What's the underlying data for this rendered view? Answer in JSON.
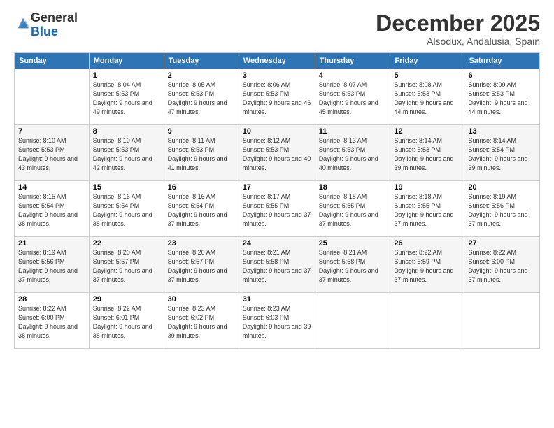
{
  "logo": {
    "general": "General",
    "blue": "Blue"
  },
  "header": {
    "month": "December 2025",
    "location": "Alsodux, Andalusia, Spain"
  },
  "weekdays": [
    "Sunday",
    "Monday",
    "Tuesday",
    "Wednesday",
    "Thursday",
    "Friday",
    "Saturday"
  ],
  "weeks": [
    [
      {
        "day": "",
        "info": ""
      },
      {
        "day": "1",
        "info": "Sunrise: 8:04 AM\nSunset: 5:53 PM\nDaylight: 9 hours\nand 49 minutes."
      },
      {
        "day": "2",
        "info": "Sunrise: 8:05 AM\nSunset: 5:53 PM\nDaylight: 9 hours\nand 47 minutes."
      },
      {
        "day": "3",
        "info": "Sunrise: 8:06 AM\nSunset: 5:53 PM\nDaylight: 9 hours\nand 46 minutes."
      },
      {
        "day": "4",
        "info": "Sunrise: 8:07 AM\nSunset: 5:53 PM\nDaylight: 9 hours\nand 45 minutes."
      },
      {
        "day": "5",
        "info": "Sunrise: 8:08 AM\nSunset: 5:53 PM\nDaylight: 9 hours\nand 44 minutes."
      },
      {
        "day": "6",
        "info": "Sunrise: 8:09 AM\nSunset: 5:53 PM\nDaylight: 9 hours\nand 44 minutes."
      }
    ],
    [
      {
        "day": "7",
        "info": "Sunrise: 8:10 AM\nSunset: 5:53 PM\nDaylight: 9 hours\nand 43 minutes."
      },
      {
        "day": "8",
        "info": "Sunrise: 8:10 AM\nSunset: 5:53 PM\nDaylight: 9 hours\nand 42 minutes."
      },
      {
        "day": "9",
        "info": "Sunrise: 8:11 AM\nSunset: 5:53 PM\nDaylight: 9 hours\nand 41 minutes."
      },
      {
        "day": "10",
        "info": "Sunrise: 8:12 AM\nSunset: 5:53 PM\nDaylight: 9 hours\nand 40 minutes."
      },
      {
        "day": "11",
        "info": "Sunrise: 8:13 AM\nSunset: 5:53 PM\nDaylight: 9 hours\nand 40 minutes."
      },
      {
        "day": "12",
        "info": "Sunrise: 8:14 AM\nSunset: 5:53 PM\nDaylight: 9 hours\nand 39 minutes."
      },
      {
        "day": "13",
        "info": "Sunrise: 8:14 AM\nSunset: 5:54 PM\nDaylight: 9 hours\nand 39 minutes."
      }
    ],
    [
      {
        "day": "14",
        "info": "Sunrise: 8:15 AM\nSunset: 5:54 PM\nDaylight: 9 hours\nand 38 minutes."
      },
      {
        "day": "15",
        "info": "Sunrise: 8:16 AM\nSunset: 5:54 PM\nDaylight: 9 hours\nand 38 minutes."
      },
      {
        "day": "16",
        "info": "Sunrise: 8:16 AM\nSunset: 5:54 PM\nDaylight: 9 hours\nand 37 minutes."
      },
      {
        "day": "17",
        "info": "Sunrise: 8:17 AM\nSunset: 5:55 PM\nDaylight: 9 hours\nand 37 minutes."
      },
      {
        "day": "18",
        "info": "Sunrise: 8:18 AM\nSunset: 5:55 PM\nDaylight: 9 hours\nand 37 minutes."
      },
      {
        "day": "19",
        "info": "Sunrise: 8:18 AM\nSunset: 5:55 PM\nDaylight: 9 hours\nand 37 minutes."
      },
      {
        "day": "20",
        "info": "Sunrise: 8:19 AM\nSunset: 5:56 PM\nDaylight: 9 hours\nand 37 minutes."
      }
    ],
    [
      {
        "day": "21",
        "info": "Sunrise: 8:19 AM\nSunset: 5:56 PM\nDaylight: 9 hours\nand 37 minutes."
      },
      {
        "day": "22",
        "info": "Sunrise: 8:20 AM\nSunset: 5:57 PM\nDaylight: 9 hours\nand 37 minutes."
      },
      {
        "day": "23",
        "info": "Sunrise: 8:20 AM\nSunset: 5:57 PM\nDaylight: 9 hours\nand 37 minutes."
      },
      {
        "day": "24",
        "info": "Sunrise: 8:21 AM\nSunset: 5:58 PM\nDaylight: 9 hours\nand 37 minutes."
      },
      {
        "day": "25",
        "info": "Sunrise: 8:21 AM\nSunset: 5:58 PM\nDaylight: 9 hours\nand 37 minutes."
      },
      {
        "day": "26",
        "info": "Sunrise: 8:22 AM\nSunset: 5:59 PM\nDaylight: 9 hours\nand 37 minutes."
      },
      {
        "day": "27",
        "info": "Sunrise: 8:22 AM\nSunset: 6:00 PM\nDaylight: 9 hours\nand 37 minutes."
      }
    ],
    [
      {
        "day": "28",
        "info": "Sunrise: 8:22 AM\nSunset: 6:00 PM\nDaylight: 9 hours\nand 38 minutes."
      },
      {
        "day": "29",
        "info": "Sunrise: 8:22 AM\nSunset: 6:01 PM\nDaylight: 9 hours\nand 38 minutes."
      },
      {
        "day": "30",
        "info": "Sunrise: 8:23 AM\nSunset: 6:02 PM\nDaylight: 9 hours\nand 39 minutes."
      },
      {
        "day": "31",
        "info": "Sunrise: 8:23 AM\nSunset: 6:03 PM\nDaylight: 9 hours\nand 39 minutes."
      },
      {
        "day": "",
        "info": ""
      },
      {
        "day": "",
        "info": ""
      },
      {
        "day": "",
        "info": ""
      }
    ]
  ]
}
